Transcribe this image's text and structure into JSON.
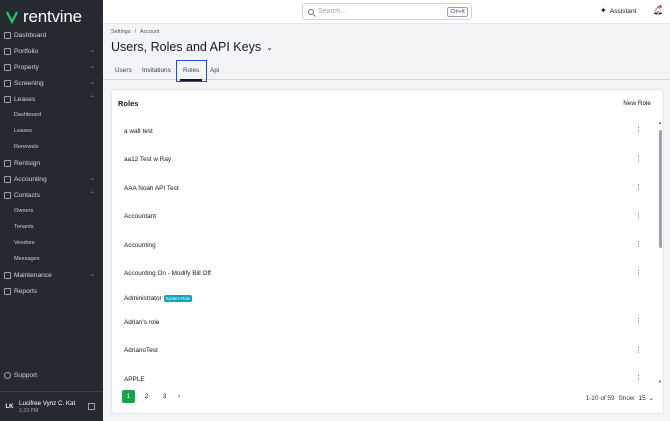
{
  "brand": {
    "name": "rentvine",
    "color": "#22c55e"
  },
  "sidebar": {
    "items": [
      {
        "label": "Dashboard",
        "chevron": ""
      },
      {
        "label": "Portfolio",
        "chevron": "⌄"
      },
      {
        "label": "Property",
        "chevron": "⌄"
      },
      {
        "label": "Screening",
        "chevron": "⌄"
      },
      {
        "label": "Leases",
        "chevron": "⌃"
      }
    ],
    "leases_sub": [
      "Dashboard",
      "Leases",
      "Renewals"
    ],
    "items2": [
      {
        "label": "Rentsign",
        "chevron": ""
      },
      {
        "label": "Accounting",
        "chevron": "⌄"
      },
      {
        "label": "Contacts",
        "chevron": "⌃"
      }
    ],
    "contacts_sub": [
      "Owners",
      "Tenants",
      "Vendors",
      "Messages"
    ],
    "items3": [
      {
        "label": "Maintenance",
        "chevron": "⌄"
      },
      {
        "label": "Reports",
        "chevron": ""
      }
    ],
    "support": "Support",
    "user": {
      "initials": "LK",
      "name": "Lucifree Vynz C. Kat",
      "time": "1:23 PM"
    }
  },
  "topbar": {
    "search_placeholder": "Search...",
    "shortcut": "Ctrl+K",
    "assistant": "Assistant"
  },
  "breadcrumb": [
    "Settings",
    "/",
    "Account"
  ],
  "page_title": "Users, Roles and API Keys",
  "tabs": [
    "Users",
    "Invitations",
    "Roles",
    "Api"
  ],
  "active_tab": "Roles",
  "roles_card": {
    "title": "Roles",
    "new_button": "New Role",
    "rows": [
      {
        "name": "a walt test",
        "badge": ""
      },
      {
        "name": "aa12 Test w Ray",
        "badge": ""
      },
      {
        "name": "AAA Noah API Test",
        "badge": ""
      },
      {
        "name": "Accountant",
        "badge": ""
      },
      {
        "name": "Accounting",
        "badge": ""
      },
      {
        "name": "Accounting On - Modify Bill Off",
        "badge": ""
      },
      {
        "name": "Administrator",
        "badge": "System Role"
      },
      {
        "name": "Adrian's role",
        "badge": ""
      },
      {
        "name": "AdrianoTest",
        "badge": ""
      },
      {
        "name": "APPLE",
        "badge": ""
      }
    ]
  },
  "pagination": {
    "pages": [
      "1",
      "2",
      "3"
    ],
    "current": "1",
    "next": "›",
    "range": "1-20 of 59",
    "show_label": "Show",
    "show_value": "15"
  }
}
